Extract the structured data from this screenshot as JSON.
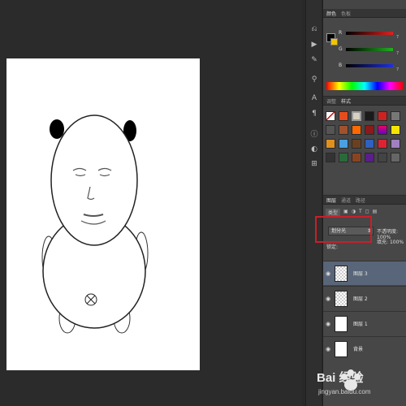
{
  "colors": {
    "accent_red": "#c8202a",
    "selected_layer": "#596578",
    "foreground_swatch": "#000000",
    "background_swatch": "#f2c500"
  },
  "color_panel": {
    "tabs": [
      "颜色",
      "色板"
    ],
    "channels": [
      {
        "label": "R",
        "value": "7",
        "color": "#e02020"
      },
      {
        "label": "G",
        "value": "7",
        "color": "#20b020"
      },
      {
        "label": "B",
        "value": "7",
        "color": "#2030e0"
      }
    ]
  },
  "styles_panel": {
    "tabs": [
      "调整",
      "样式"
    ]
  },
  "layers_panel": {
    "tabs": [
      "图层",
      "通道",
      "路径"
    ],
    "filter_label": "类型",
    "blend_mode": "划分光",
    "opacity_label": "不透明度:",
    "opacity_value": "100%",
    "fill_label": "填充:",
    "fill_value": "100%",
    "lock_label": "锁定:",
    "layers": [
      {
        "name": "图层 3",
        "selected": true
      },
      {
        "name": "图层 2",
        "selected": false
      },
      {
        "name": "图层 1",
        "selected": false
      },
      {
        "name": "背景",
        "selected": false
      }
    ]
  },
  "toolbar": {
    "icons": [
      "history-icon",
      "actions-icon",
      "brush-icon",
      "clone-icon",
      "character-icon",
      "paragraph-icon",
      "info-icon",
      "adjust-icon",
      "navigator-icon"
    ]
  },
  "watermark": {
    "brand": "Bai 经验",
    "url": "jingyan.baidu.com"
  }
}
